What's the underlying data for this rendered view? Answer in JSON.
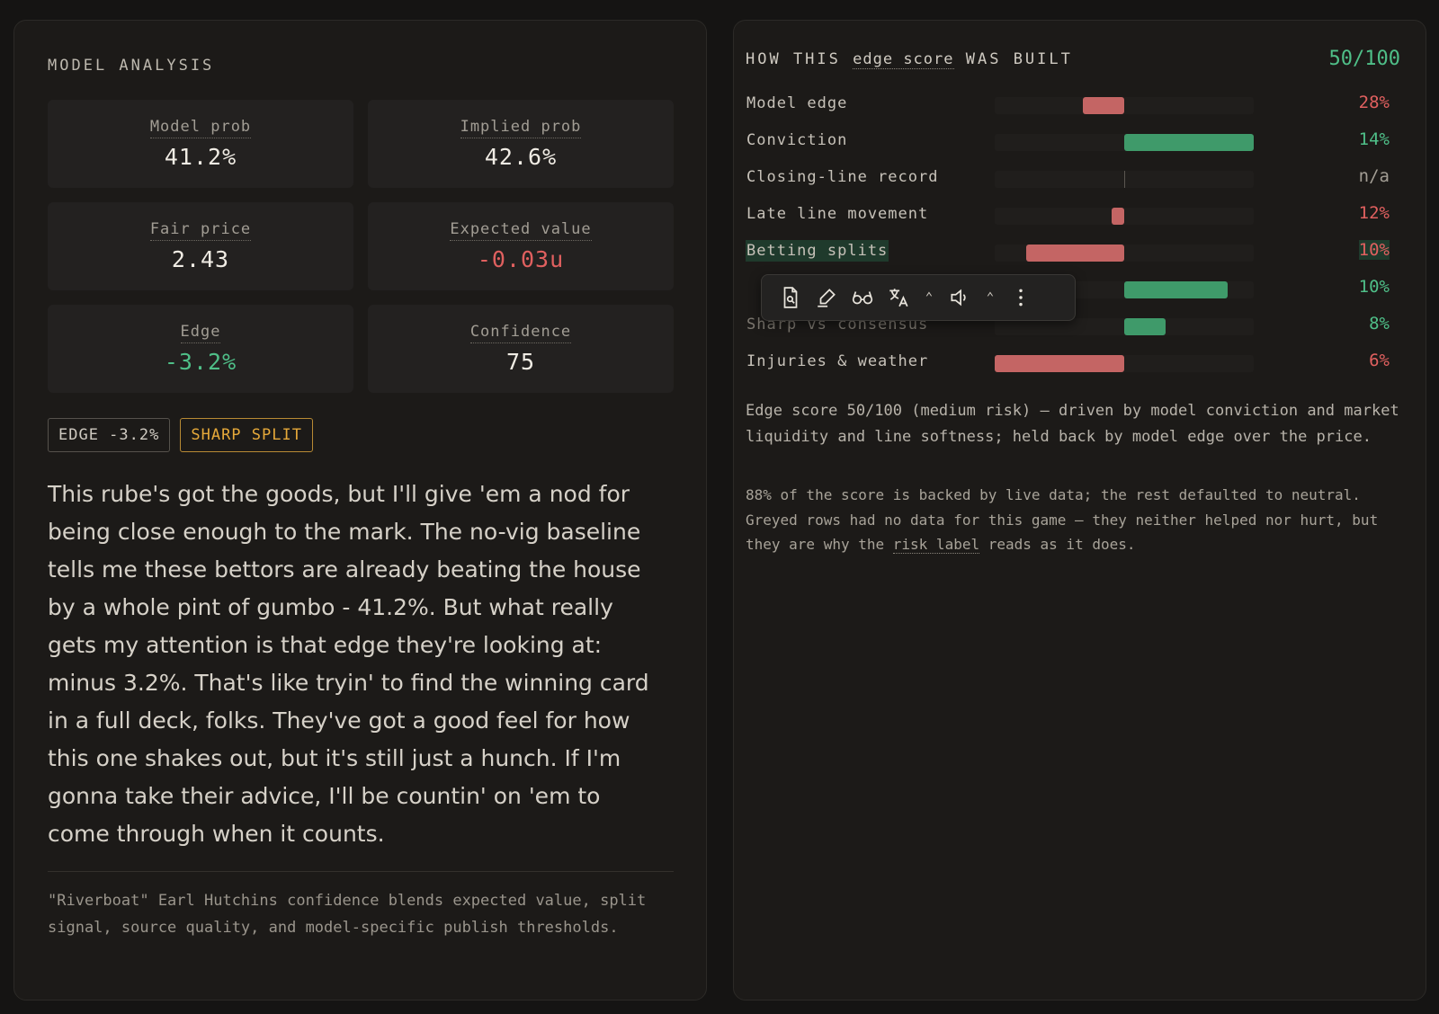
{
  "left": {
    "title": "MODEL ANALYSIS",
    "metrics": [
      {
        "label": "Model prob",
        "value": "41.2%"
      },
      {
        "label": "Implied prob",
        "value": "42.6%"
      },
      {
        "label": "Fair price",
        "value": "2.43"
      },
      {
        "label": "Expected value",
        "value": "-0.03u"
      },
      {
        "label": "Edge",
        "value": "-3.2%"
      },
      {
        "label": "Confidence",
        "value": "75"
      }
    ],
    "chips": [
      "EDGE -3.2%",
      "SHARP SPLIT"
    ],
    "analysis": "This rube's got the goods, but I'll give 'em a nod for being close enough to the mark. The no-vig baseline tells me these bettors are already beating the house by a whole pint of gumbo - 41.2%. But what really gets my attention is that edge they're looking at: minus 3.2%. That's like tryin' to find the winning card in a full deck, folks. They've got a good feel for how this one shakes out, but it's still just a hunch. If I'm gonna take their advice, I'll be countin' on 'em to come through when it counts.",
    "footnote": "\"Riverboat\" Earl Hutchins confidence blends expected value, split signal, source quality, and model-specific publish thresholds."
  },
  "right": {
    "title_pre": "HOW THIS",
    "title_term": "edge score",
    "title_post": "WAS BUILT",
    "score": "50/100",
    "rows": [
      {
        "label": "Model edge",
        "pct": "28%",
        "sign": "neg",
        "value": -0.16
      },
      {
        "label": "Conviction",
        "pct": "14%",
        "sign": "pos",
        "value": 0.5
      },
      {
        "label": "Closing-line record",
        "pct": "n/a",
        "sign": "na",
        "value": 0
      },
      {
        "label": "Late line movement",
        "pct": "12%",
        "sign": "neg",
        "value": -0.05
      },
      {
        "label": "Betting splits",
        "pct": "10%",
        "sign": "neg",
        "value": -0.38
      },
      {
        "label": "",
        "pct": "10%",
        "sign": "pos",
        "value": 0.4
      },
      {
        "label": "Sharp vs consensus",
        "pct": "8%",
        "sign": "pos",
        "value": 0.16
      },
      {
        "label": "Injuries & weather",
        "pct": "6%",
        "sign": "neg",
        "value": -0.5
      }
    ],
    "summary": "Edge score 50/100 (medium risk) — driven by model conviction and market liquidity and line softness; held back by model edge over the price.",
    "summary2_pre": "88% of the score is backed by live data; the rest defaulted to neutral. Greyed rows had no data for this game — they neither helped nor hurt, but they are why the",
    "summary2_term": "risk label",
    "summary2_post": "reads as it does."
  },
  "toolbar": {
    "icons": [
      "read-page-icon",
      "highlighter-icon",
      "glasses-icon",
      "translate-icon",
      "speaker-icon",
      "more-icon"
    ]
  }
}
